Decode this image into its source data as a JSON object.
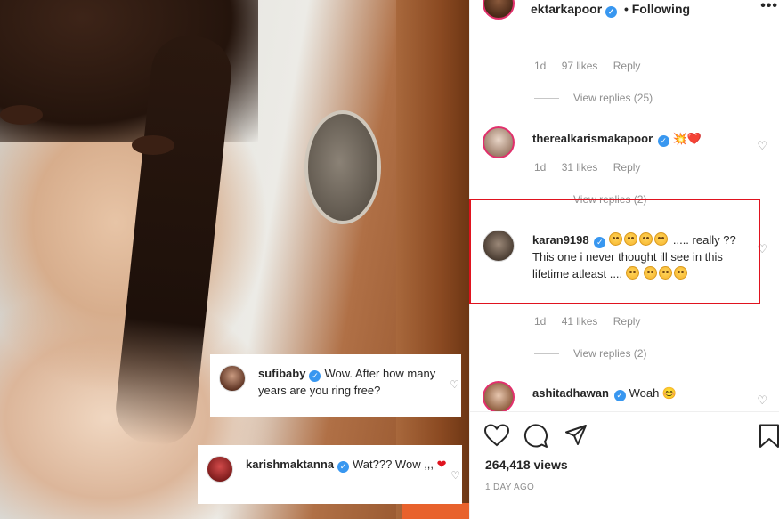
{
  "overlay_comments": [
    {
      "username": "sufibaby",
      "text": "Wow. After how many years are you ring free?"
    },
    {
      "username": "karishmaktanna",
      "text": "Wat??? Wow ,,,"
    }
  ],
  "header": {
    "username": "ektarkapoor",
    "separator": "•",
    "follow_status": "Following",
    "more": "•••"
  },
  "comments": [
    {
      "age": "1d",
      "likes": "97 likes",
      "reply": "Reply",
      "view_replies": "View replies (25)"
    },
    {
      "username": "therealkarismakapoor",
      "text": "💥❤️",
      "age": "1d",
      "likes": "31 likes",
      "reply": "Reply",
      "view_replies": "View replies (2)"
    },
    {
      "username": "karan9198",
      "text_a": " .....",
      "text_b": "really ?? This one i never thought ill see in this lifetime atleast ....",
      "age": "1d",
      "likes": "41 likes",
      "reply": "Reply",
      "view_replies": "View replies (2)"
    },
    {
      "username": "ashitadhawan",
      "text": "Woah 😊"
    }
  ],
  "views": "264,418 views",
  "date": "1 DAY AGO",
  "icons": {
    "heart": "heart-icon",
    "comment": "comment-icon",
    "share": "share-icon",
    "bookmark": "bookmark-icon",
    "verified": "verified-badge-icon"
  },
  "colors": {
    "highlight": "#e0131f",
    "verified": "#3897f0",
    "meta": "#8e8e8e"
  }
}
